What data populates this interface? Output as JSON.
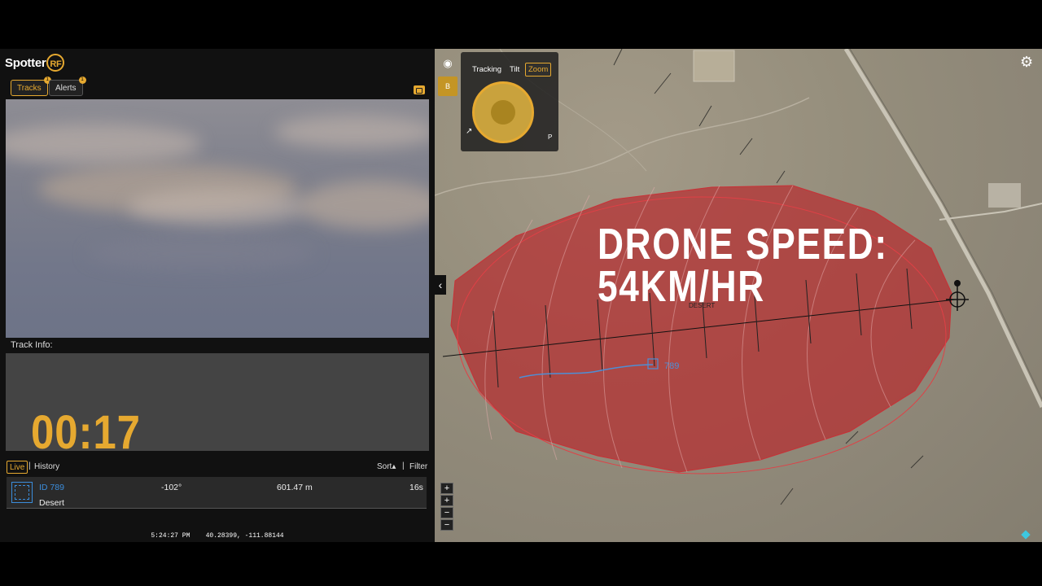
{
  "logo": {
    "word": "Spotter",
    "suffix": "RF"
  },
  "tabs": [
    {
      "label": "Tracks",
      "badge": "1",
      "active": true
    },
    {
      "label": "Alerts",
      "badge": "1",
      "active": false
    }
  ],
  "track_info": {
    "label": "Track Info:",
    "timer": "00:17"
  },
  "list_controls": {
    "live": "Live",
    "separator": "|",
    "history": "History",
    "sort": "Sort▴",
    "filter": "Filter"
  },
  "tracks": [
    {
      "id": "ID 789",
      "name": "Desert",
      "bearing": "-102°",
      "distance": "601.47 m",
      "age": "16s"
    }
  ],
  "status_bar": {
    "time": "5:24:27 PM",
    "coords": "40.28399, -111.88144"
  },
  "camera_controls": {
    "tabs": [
      "Tracking",
      "Tilt",
      "Zoom"
    ],
    "active_tab": "Zoom",
    "b_button": "B",
    "p_label": "P"
  },
  "map": {
    "overlay_line1": "DRONE SPEED:",
    "overlay_line2": "54KM/HR",
    "track_label": "789",
    "zone_label": "DESERT",
    "zoom_buttons": [
      "+",
      "+",
      "−",
      "−"
    ]
  },
  "colors": {
    "accent": "#e6a930",
    "track_blue": "#3b8ddb",
    "zone_red": "#b8262b"
  }
}
